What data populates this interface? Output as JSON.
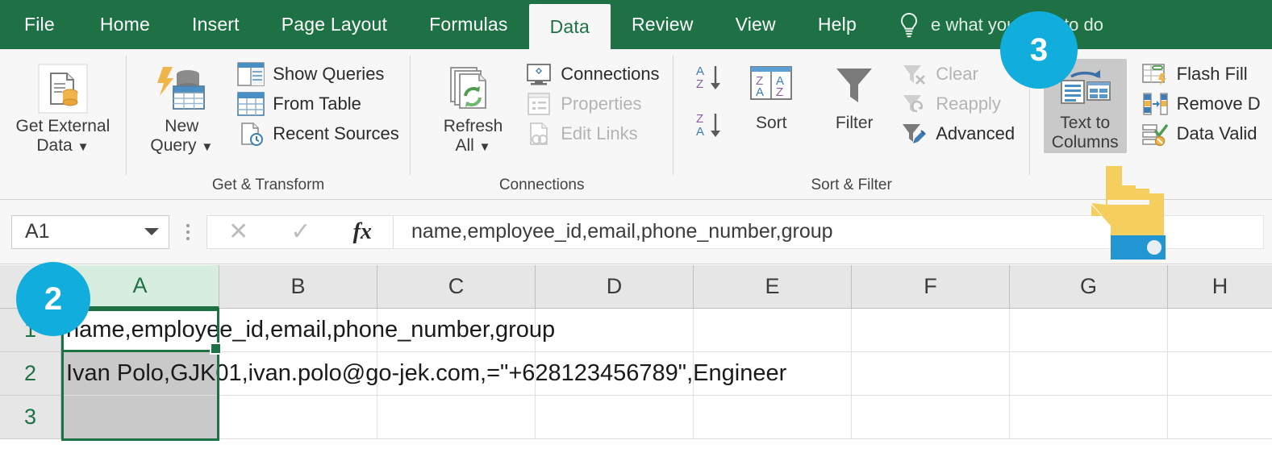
{
  "app": {
    "ribbon_tabs": [
      {
        "label": "File",
        "active": false
      },
      {
        "label": "Home",
        "active": false
      },
      {
        "label": "Insert",
        "active": false
      },
      {
        "label": "Page Layout",
        "active": false
      },
      {
        "label": "Formulas",
        "active": false
      },
      {
        "label": "Data",
        "active": true
      },
      {
        "label": "Review",
        "active": false
      },
      {
        "label": "View",
        "active": false
      },
      {
        "label": "Help",
        "active": false
      }
    ],
    "tell_me": {
      "icon": "lightbulb-icon",
      "placeholder": "Tell me what you want to do",
      "visible_text": "e what you want to do"
    }
  },
  "ribbon": {
    "groups": [
      {
        "title": "",
        "big_buttons": [
          {
            "label_line1": "Get External",
            "label_line2": "Data",
            "has_dropdown": true,
            "icon": "get-external-data-icon"
          }
        ],
        "small_buttons": []
      },
      {
        "title": "Get & Transform",
        "big_buttons": [
          {
            "label_line1": "New",
            "label_line2": "Query",
            "has_dropdown": true,
            "icon": "new-query-icon"
          }
        ],
        "small_buttons": [
          {
            "label": "Show Queries",
            "icon": "show-queries-icon",
            "disabled": false
          },
          {
            "label": "From Table",
            "icon": "from-table-icon",
            "disabled": false
          },
          {
            "label": "Recent Sources",
            "icon": "recent-sources-icon",
            "disabled": false
          }
        ]
      },
      {
        "title": "Connections",
        "big_buttons": [
          {
            "label_line1": "Refresh",
            "label_line2": "All",
            "has_dropdown": true,
            "icon": "refresh-all-icon"
          }
        ],
        "small_buttons": [
          {
            "label": "Connections",
            "icon": "connections-icon",
            "disabled": false
          },
          {
            "label": "Properties",
            "icon": "properties-icon",
            "disabled": true
          },
          {
            "label": "Edit Links",
            "icon": "edit-links-icon",
            "disabled": true
          }
        ]
      },
      {
        "title": "Sort & Filter",
        "big_buttons": [
          {
            "label_line1": "Sort",
            "label_line2": "",
            "has_dropdown": false,
            "icon": "sort-icon"
          },
          {
            "label_line1": "Filter",
            "label_line2": "",
            "has_dropdown": false,
            "icon": "filter-icon"
          }
        ],
        "small_buttons": [
          {
            "label": "Clear",
            "icon": "clear-filter-icon",
            "disabled": true
          },
          {
            "label": "Reapply",
            "icon": "reapply-filter-icon",
            "disabled": true
          },
          {
            "label": "Advanced",
            "icon": "advanced-filter-icon",
            "disabled": false
          }
        ],
        "sort_az_label": "sort-ascending-icon",
        "sort_za_label": "sort-descending-icon"
      },
      {
        "title": "",
        "big_buttons": [
          {
            "label_line1": "Text to",
            "label_line2": "Columns",
            "has_dropdown": false,
            "icon": "text-to-columns-icon",
            "highlighted": true
          }
        ],
        "small_buttons": [
          {
            "label": "Flash Fill",
            "icon": "flash-fill-icon",
            "disabled": false
          },
          {
            "label": "Remove D",
            "icon": "remove-duplicates-icon",
            "disabled": false
          },
          {
            "label": "Data Valid",
            "icon": "data-validation-icon",
            "disabled": false
          }
        ]
      }
    ]
  },
  "formula_bar": {
    "name_box_value": "A1",
    "cancel_icon": "cancel-x-icon",
    "confirm_icon": "confirm-check-icon",
    "function_icon": "fx",
    "formula_value": "name,employee_id,email,phone_number,group"
  },
  "grid": {
    "column_headers": [
      "A",
      "B",
      "C",
      "D",
      "E",
      "F",
      "G",
      "H"
    ],
    "selected_column": "A",
    "row_headers": [
      "1",
      "2",
      "3"
    ],
    "active_cell": "A1",
    "rows": [
      {
        "number": "1",
        "a_value": "name,employee_id,email,phone_number,group"
      },
      {
        "number": "2",
        "a_value": "Ivan Polo,GJK01,ivan.polo@go-jek.com,=\"+628123456789\",Engineer"
      },
      {
        "number": "3",
        "a_value": ""
      }
    ]
  },
  "annotations": {
    "badge2": "2",
    "badge3": "3",
    "cursor": "pointing-hand-cursor"
  },
  "colors": {
    "excel_green": "#1e7145",
    "badge_cyan": "#11ADDC",
    "ribbon_bg": "#f7f7f7",
    "hand_yellow": "#F5CF5E",
    "cuff_blue": "#2196D3"
  }
}
